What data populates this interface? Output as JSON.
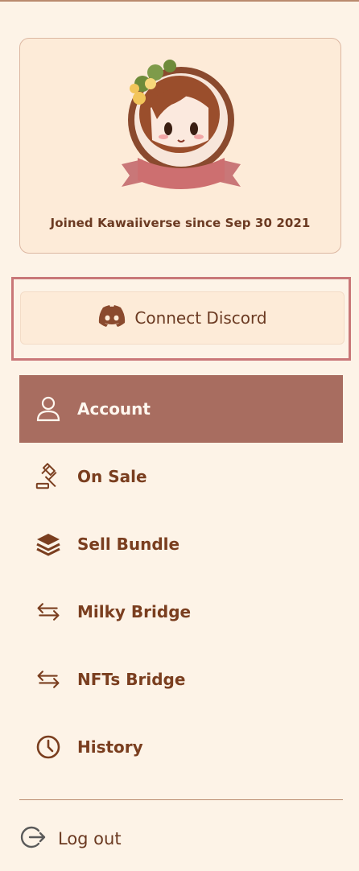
{
  "profile": {
    "joined_text": "Joined Kawaiiverse since Sep 30 2021"
  },
  "discord": {
    "label": "Connect Discord"
  },
  "menu": {
    "items": [
      {
        "label": "Account",
        "icon": "user-icon"
      },
      {
        "label": "On Sale",
        "icon": "gavel-icon"
      },
      {
        "label": "Sell Bundle",
        "icon": "layers-icon"
      },
      {
        "label": "Milky Bridge",
        "icon": "swap-arrows-icon"
      },
      {
        "label": "NFTs Bridge",
        "icon": "swap-arrows-icon"
      },
      {
        "label": "History",
        "icon": "clock-icon"
      }
    ],
    "active_index": 0
  },
  "logout": {
    "label": "Log out",
    "icon": "logout-icon"
  },
  "colors": {
    "background": "#fdf3e7",
    "accent": "#a86d60",
    "text": "#7a3e1f",
    "highlight_border": "#c97778"
  }
}
